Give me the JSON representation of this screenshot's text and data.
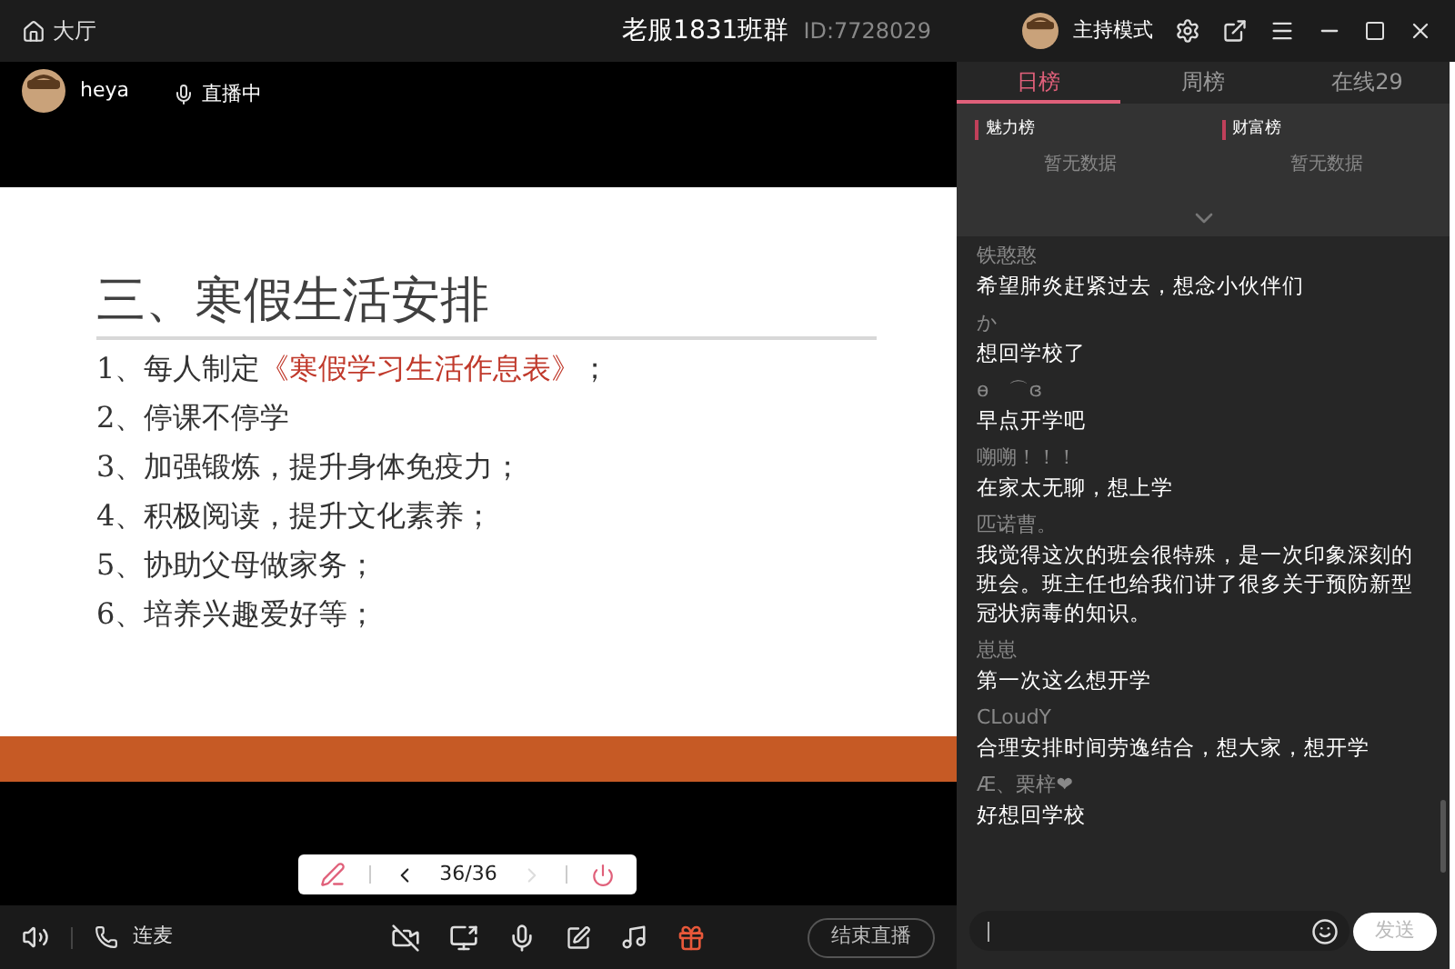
{
  "titlebar": {
    "home": "大厅",
    "title": "老服1831班群",
    "room_id": "ID:7728029",
    "mode": "主持模式"
  },
  "host": {
    "name": "heya",
    "status": "直播中"
  },
  "slide": {
    "heading": "三、寒假生活安排",
    "items": [
      [
        {
          "text": "1、每人制定",
          "emphasis": false
        },
        {
          "text": "《寒假学习生活作息表》",
          "emphasis": true
        },
        {
          "text": "；",
          "emphasis": false
        }
      ],
      [
        {
          "text": "2、停课不停学",
          "emphasis": false
        }
      ],
      [
        {
          "text": "3、加强锻炼，提升身体免疫力；",
          "emphasis": false
        }
      ],
      [
        {
          "text": "4、积极阅读，提升文化素养；",
          "emphasis": false
        }
      ],
      [
        {
          "text": "5、协助父母做家务；",
          "emphasis": false
        }
      ],
      [
        {
          "text": "6、培养兴趣爱好等；",
          "emphasis": false
        }
      ]
    ]
  },
  "pager": {
    "page": "36/36",
    "prev_disabled": false,
    "next_disabled": true
  },
  "bottom_bar": {
    "link_mic": "连麦",
    "end_button": "结束直播"
  },
  "tabs": [
    {
      "label": "日榜",
      "selected": true
    },
    {
      "label": "周榜",
      "selected": false
    },
    {
      "label": "在线29",
      "selected": false
    }
  ],
  "rankings": [
    {
      "title": "魅力榜",
      "empty": "暂无数据"
    },
    {
      "title": "财富榜",
      "empty": "暂无数据"
    }
  ],
  "chat": [
    {
      "user": "铁憨憨",
      "message": "希望肺炎赶紧过去，想念小伙伴们"
    },
    {
      "user": "か",
      "message": "想回学校了"
    },
    {
      "user": "ɵ　⌒ɞ",
      "message": "早点开学吧"
    },
    {
      "user": "嗍嗍！！！",
      "message": "在家太无聊，想上学"
    },
    {
      "user": "匹诺曹。",
      "message": "我觉得这次的班会很特殊，是一次印象深刻的班会。班主任也给我们讲了很多关于预防新型冠状病毒的知识。"
    },
    {
      "user": "崽崽",
      "message": "第一次这么想开学"
    },
    {
      "user": "CLoudY",
      "message": "合理安排时间劳逸结合，想大家，想开学"
    },
    {
      "user": "Æ、栗梓❤",
      "message": "好想回学校"
    }
  ],
  "composer": {
    "send": "发送"
  }
}
